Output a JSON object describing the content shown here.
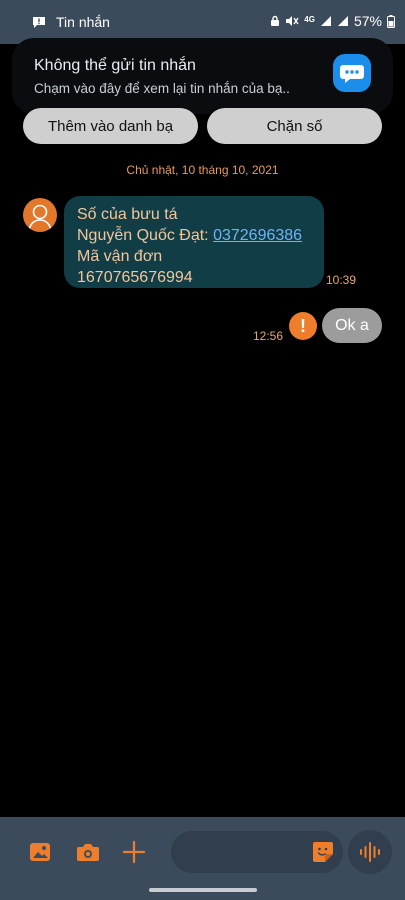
{
  "status_bar": {
    "app_label": "Tin nhắn",
    "network": "4G",
    "battery": "57%"
  },
  "notification": {
    "title": "Không thể gửi tin nhắn",
    "body": "Chạm vào đây để xem lại tin nhắn của bạ.."
  },
  "actions": {
    "add_contact": "Thêm vào danh bạ",
    "block_number": "Chặn số"
  },
  "conversation": {
    "date": "Chủ nhật, 10 tháng 10, 2021",
    "incoming": {
      "line1": "Số của bưu tá",
      "line2_prefix": "Nguyễn Quốc Đạt: ",
      "phone": "0372696386",
      "line3": "Mã vận đơn",
      "line4": "1670765676994",
      "time": "10:39"
    },
    "outgoing": {
      "error_mark": "!",
      "text": "Ok a",
      "time": "12:56"
    }
  },
  "colors": {
    "accent": "#ee7e2b",
    "bar_background": "#3c4b5c",
    "incoming_bubble": "#113d46",
    "link": "#6fb4f3"
  },
  "icons": [
    "message-app-icon",
    "gallery-icon",
    "camera-icon",
    "plus-icon",
    "sticker-icon",
    "voice-icon"
  ]
}
